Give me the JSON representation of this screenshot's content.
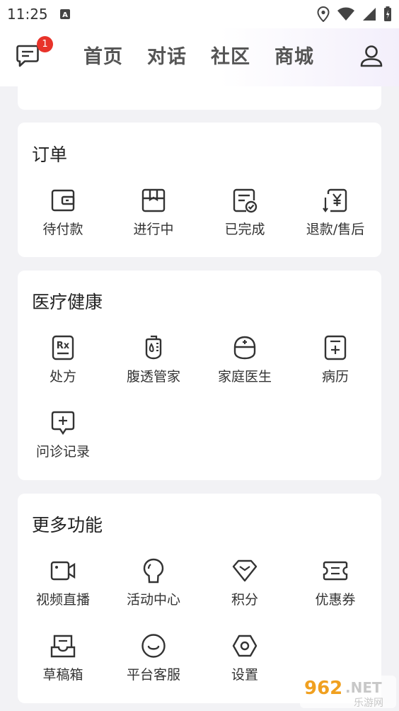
{
  "status_bar": {
    "time": "11:25"
  },
  "header": {
    "message_badge": "1",
    "nav": [
      "首页",
      "对话",
      "社区",
      "商城"
    ]
  },
  "orders": {
    "title": "订单",
    "items": [
      {
        "label": "待付款",
        "icon": "wallet-icon"
      },
      {
        "label": "进行中",
        "icon": "box-icon"
      },
      {
        "label": "已完成",
        "icon": "receipt-check-icon"
      },
      {
        "label": "退款/售后",
        "icon": "refund-icon"
      }
    ]
  },
  "health": {
    "title": "医疗健康",
    "items": [
      {
        "label": "处方",
        "icon": "prescription-icon"
      },
      {
        "label": "腹透管家",
        "icon": "dialysis-bag-icon"
      },
      {
        "label": "家庭医生",
        "icon": "doctor-icon"
      },
      {
        "label": "病历",
        "icon": "medical-record-icon"
      },
      {
        "label": "问诊记录",
        "icon": "consult-record-icon"
      }
    ]
  },
  "more": {
    "title": "更多功能",
    "items": [
      {
        "label": "视频直播",
        "icon": "video-camera-icon"
      },
      {
        "label": "活动中心",
        "icon": "lightbulb-icon"
      },
      {
        "label": "积分",
        "icon": "diamond-icon"
      },
      {
        "label": "优惠券",
        "icon": "coupon-icon"
      },
      {
        "label": "草稿箱",
        "icon": "inbox-icon"
      },
      {
        "label": "平台客服",
        "icon": "smile-icon"
      },
      {
        "label": "设置",
        "icon": "settings-hex-icon"
      }
    ]
  },
  "watermark": {
    "brand": "962.NET",
    "sub": "乐游网"
  },
  "colors": {
    "accent": "#e8332a",
    "background": "#f2f2f5",
    "card": "#ffffff"
  }
}
